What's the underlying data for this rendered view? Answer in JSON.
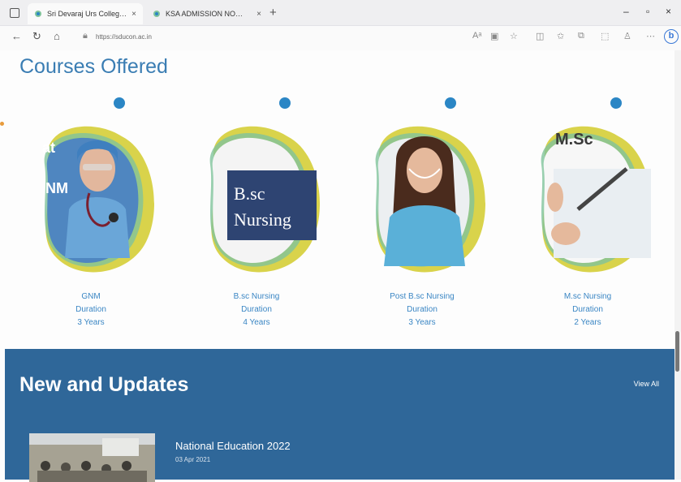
{
  "browser": {
    "tabs": [
      {
        "label": "Sri Devaraj Urs College of Nurs",
        "active": true
      },
      {
        "label": "KSA ADMISSION NOTICE",
        "active": false
      }
    ],
    "url": "https://sducon.ac.in",
    "profile_initial": "b"
  },
  "courses_section": {
    "title": "Courses Offered",
    "courses": [
      {
        "name": "GNM",
        "duration_label": "Duration",
        "duration": "3 Years",
        "image_text": "at\n\nNM"
      },
      {
        "name": "B.sc Nursing",
        "duration_label": "Duration",
        "duration": "4 Years",
        "image_text_1": "B.sc",
        "image_text_2": "Nursing"
      },
      {
        "name": "Post B.sc Nursing",
        "duration_label": "Duration",
        "duration": "3 Years"
      },
      {
        "name": "M.sc Nursing",
        "duration_label": "Duration",
        "duration": "2 Years",
        "image_text": "M.Sc"
      }
    ]
  },
  "updates_section": {
    "title": "New and Updates",
    "view_all": "View All",
    "items": [
      {
        "title": "National Education 2022",
        "date": "03 Apr 2021"
      }
    ]
  },
  "colors": {
    "accent_blue": "#3a7db3",
    "updates_bg": "#2f6799",
    "blob_yellow": "#d9d34b",
    "blob_green": "#7fc39b",
    "dot_blue": "#2b86c5"
  }
}
